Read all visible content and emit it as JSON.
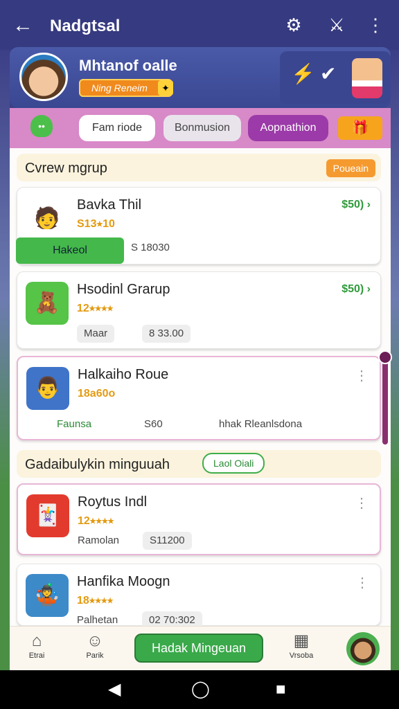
{
  "topbar": {
    "title": "Nadgtsal",
    "icons": [
      "arrow-left-icon",
      "puzzle-icon",
      "cross-swords-icon",
      "more-vertical-icon"
    ]
  },
  "profile": {
    "name": "Mhtanof oalle",
    "badge": "Ning Reneim"
  },
  "tabs": [
    {
      "label": "Fam riode"
    },
    {
      "label": "Bonmusion"
    },
    {
      "label": "Aopnathion",
      "active": true
    }
  ],
  "sections": [
    {
      "title": "Cvrew mgrup",
      "button": "Poueain"
    },
    {
      "title": "Gadaibulykin minguuah",
      "button": "Laol Oiali"
    }
  ],
  "cards": [
    {
      "name": "Bavka Thil",
      "rating": "S13⭑10",
      "price": "$50) ›",
      "action": "Hakeol",
      "meta": "S 18030"
    },
    {
      "name": "Hsodinl Grarup",
      "rating": "12⭑⭑⭑⭑",
      "price": "$50) ›",
      "chip1": "Maar",
      "chip2": "8 33.00"
    },
    {
      "name": "Halkaiho Roue",
      "rating": "18a60o",
      "tag1": "Faunsa",
      "tag2": "S60",
      "tag3": "hhak Rleanlsdona"
    },
    {
      "name": "Roytus Indl",
      "rating": "12⭑⭑⭑⭑",
      "meta1": "Ramolan",
      "chip": "S11200"
    },
    {
      "name": "Hanfika Moogn",
      "rating": "18⭑⭑⭑⭑",
      "meta1": "Palhetan",
      "chip": "02 70:302"
    }
  ],
  "bottomnav": {
    "items": [
      {
        "label": "Etrai",
        "icon": "home-icon"
      },
      {
        "label": "Parik",
        "icon": "profile-icon"
      },
      {
        "label": "Vrsoba",
        "icon": "building-icon"
      }
    ],
    "cta": "Hadak Mingeuan"
  },
  "colors": {
    "topbar": "#363a80",
    "tabs_bar": "#d889c8",
    "accent_green": "#39a949",
    "accent_orange": "#f59a2f",
    "price_green": "#2f9a3a"
  }
}
